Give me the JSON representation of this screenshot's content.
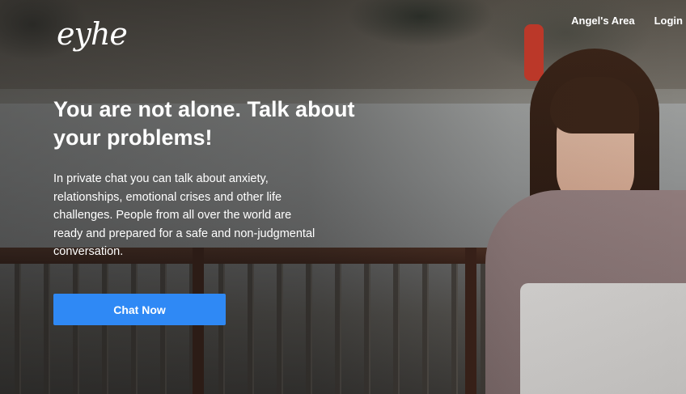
{
  "brand": {
    "logo_text": "eyhe"
  },
  "nav": {
    "items": [
      "Angel's Area",
      "Login"
    ]
  },
  "hero": {
    "headline": "You are not alone. Talk about your problems!",
    "description": "In private chat you can talk about anxiety, relationships, emotional crises and other life challenges. People from all over the world are ready and prepared for a safe and non-judgmental conversation.",
    "cta_label": "Chat Now"
  },
  "colors": {
    "cta_background": "#2f89f5",
    "text": "#ffffff"
  }
}
